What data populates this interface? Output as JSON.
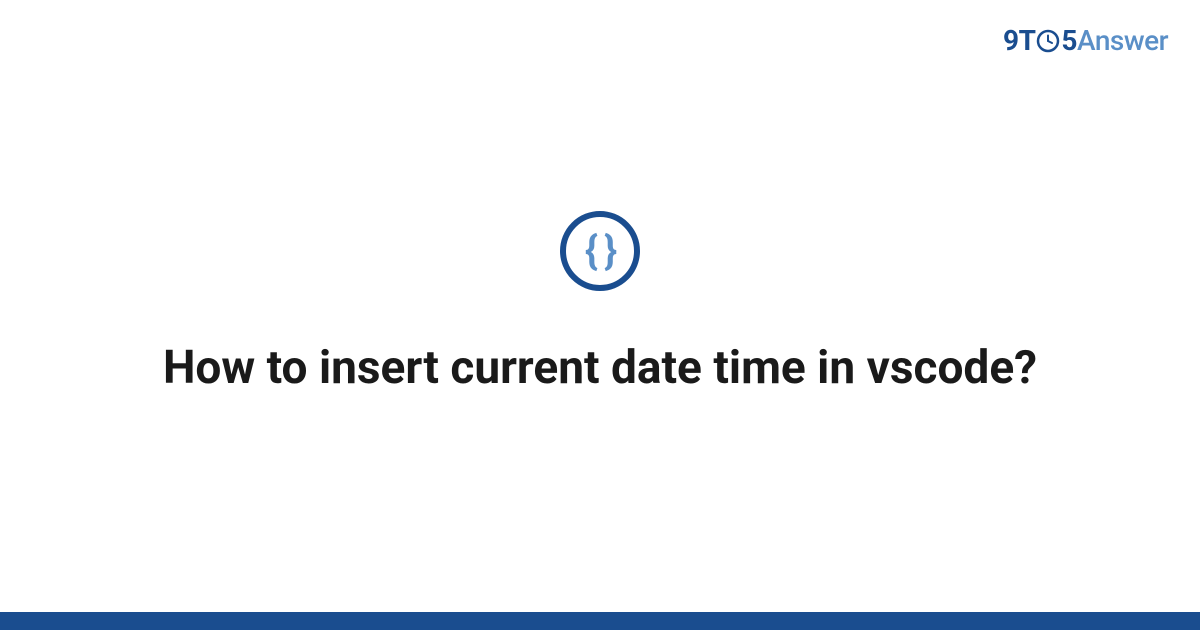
{
  "logo": {
    "prefix": "9T",
    "middle": "5",
    "suffix": "Answer"
  },
  "category_icon": {
    "glyph": "{ }",
    "name": "code-braces"
  },
  "title": "How to insert current date time in vscode?",
  "colors": {
    "primary": "#1a4d8f",
    "secondary": "#5a8fc7"
  }
}
